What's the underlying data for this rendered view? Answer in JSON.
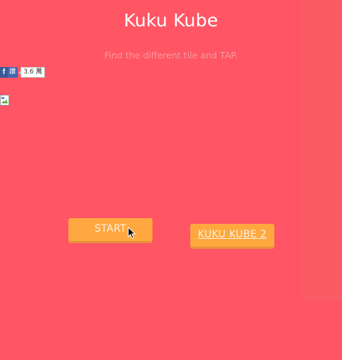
{
  "app": {
    "title": "Kuku Kube",
    "subtitle": "Find the different tile and TAP."
  },
  "facebook_like": {
    "icon": "f",
    "label": "讚",
    "count": "3.6 萬"
  },
  "broken_image": {
    "icon": "broken-image-icon"
  },
  "buttons": {
    "start_label": "START",
    "kuku_kube2_label": "KUKU KUBE 2"
  },
  "colors": {
    "background": "#ff5564",
    "button": "#ffa83f",
    "facebook": "#4267b2"
  }
}
